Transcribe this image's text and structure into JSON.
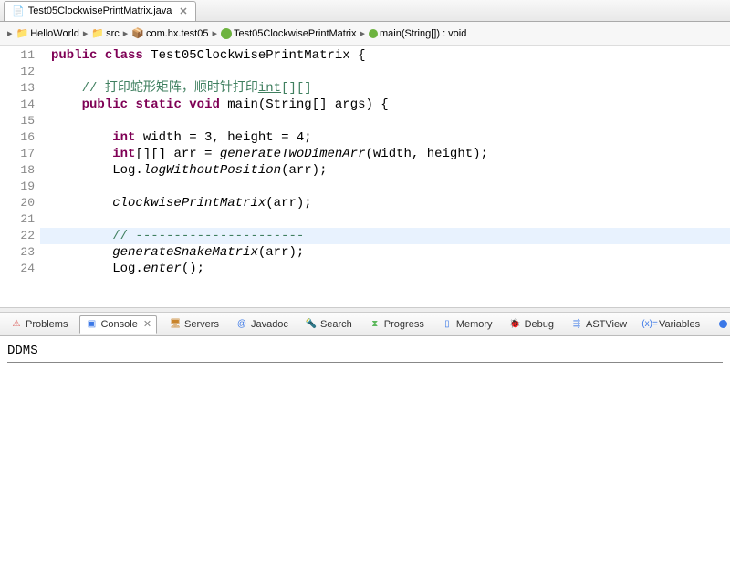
{
  "tab": {
    "title": "Test05ClockwisePrintMatrix.java"
  },
  "breadcrumb": {
    "items": [
      {
        "label": "HelloWorld"
      },
      {
        "label": "src"
      },
      {
        "label": "com.hx.test05"
      },
      {
        "label": "Test05ClockwisePrintMatrix"
      },
      {
        "label": "main(String[]) : void"
      }
    ]
  },
  "code": {
    "startLine": 11,
    "lines": [
      {
        "n": 11,
        "segs": [
          [
            "kw",
            "public"
          ],
          [
            "",
            " "
          ],
          [
            "kw",
            "class"
          ],
          [
            "",
            " Test05ClockwisePrintMatrix {"
          ]
        ]
      },
      {
        "n": 12,
        "segs": [
          [
            "",
            ""
          ]
        ]
      },
      {
        "n": 13,
        "segs": [
          [
            "",
            "    "
          ],
          [
            "cm",
            "// 打印蛇形矩阵，顺时针打印"
          ],
          [
            "cmu",
            "int"
          ],
          [
            "cm",
            "[][]"
          ]
        ]
      },
      {
        "n": 14,
        "segs": [
          [
            "",
            "    "
          ],
          [
            "kw",
            "public"
          ],
          [
            "",
            " "
          ],
          [
            "kw",
            "static"
          ],
          [
            "",
            " "
          ],
          [
            "kw",
            "void"
          ],
          [
            "",
            " main(String[] args) {"
          ]
        ]
      },
      {
        "n": 15,
        "segs": [
          [
            "",
            ""
          ]
        ]
      },
      {
        "n": 16,
        "segs": [
          [
            "",
            "        "
          ],
          [
            "kw",
            "int"
          ],
          [
            "",
            " width = 3, height = 4;"
          ]
        ]
      },
      {
        "n": 17,
        "segs": [
          [
            "",
            "        "
          ],
          [
            "kw",
            "int"
          ],
          [
            "",
            "[][] arr = "
          ],
          [
            "mi",
            "generateTwoDimenArr"
          ],
          [
            "",
            "(width, height);"
          ]
        ]
      },
      {
        "n": 18,
        "segs": [
          [
            "",
            "        Log."
          ],
          [
            "mi",
            "logWithoutPosition"
          ],
          [
            "",
            "(arr);"
          ]
        ]
      },
      {
        "n": 19,
        "segs": [
          [
            "",
            ""
          ]
        ]
      },
      {
        "n": 20,
        "segs": [
          [
            "",
            "        "
          ],
          [
            "mi",
            "clockwisePrintMatrix"
          ],
          [
            "",
            "(arr);"
          ]
        ]
      },
      {
        "n": 21,
        "segs": [
          [
            "",
            ""
          ]
        ]
      },
      {
        "n": 22,
        "hl": true,
        "segs": [
          [
            "",
            "        "
          ],
          [
            "cm",
            "// ----------------------"
          ]
        ]
      },
      {
        "n": 23,
        "segs": [
          [
            "",
            "        "
          ],
          [
            "mi",
            "generateSnakeMatrix"
          ],
          [
            "",
            "(arr);"
          ]
        ]
      },
      {
        "n": 24,
        "segs": [
          [
            "",
            "        Log."
          ],
          [
            "mi",
            "enter"
          ],
          [
            "",
            "();"
          ]
        ]
      }
    ]
  },
  "panel": {
    "tabs": {
      "problems": "Problems",
      "console": "Console",
      "servers": "Servers",
      "javadoc": "Javadoc",
      "search": "Search",
      "progress": "Progress",
      "memory": "Memory",
      "debug": "Debug",
      "astview": "ASTView",
      "variables": "Variables",
      "breakpoints": "Breakp"
    },
    "console_title": "DDMS"
  }
}
